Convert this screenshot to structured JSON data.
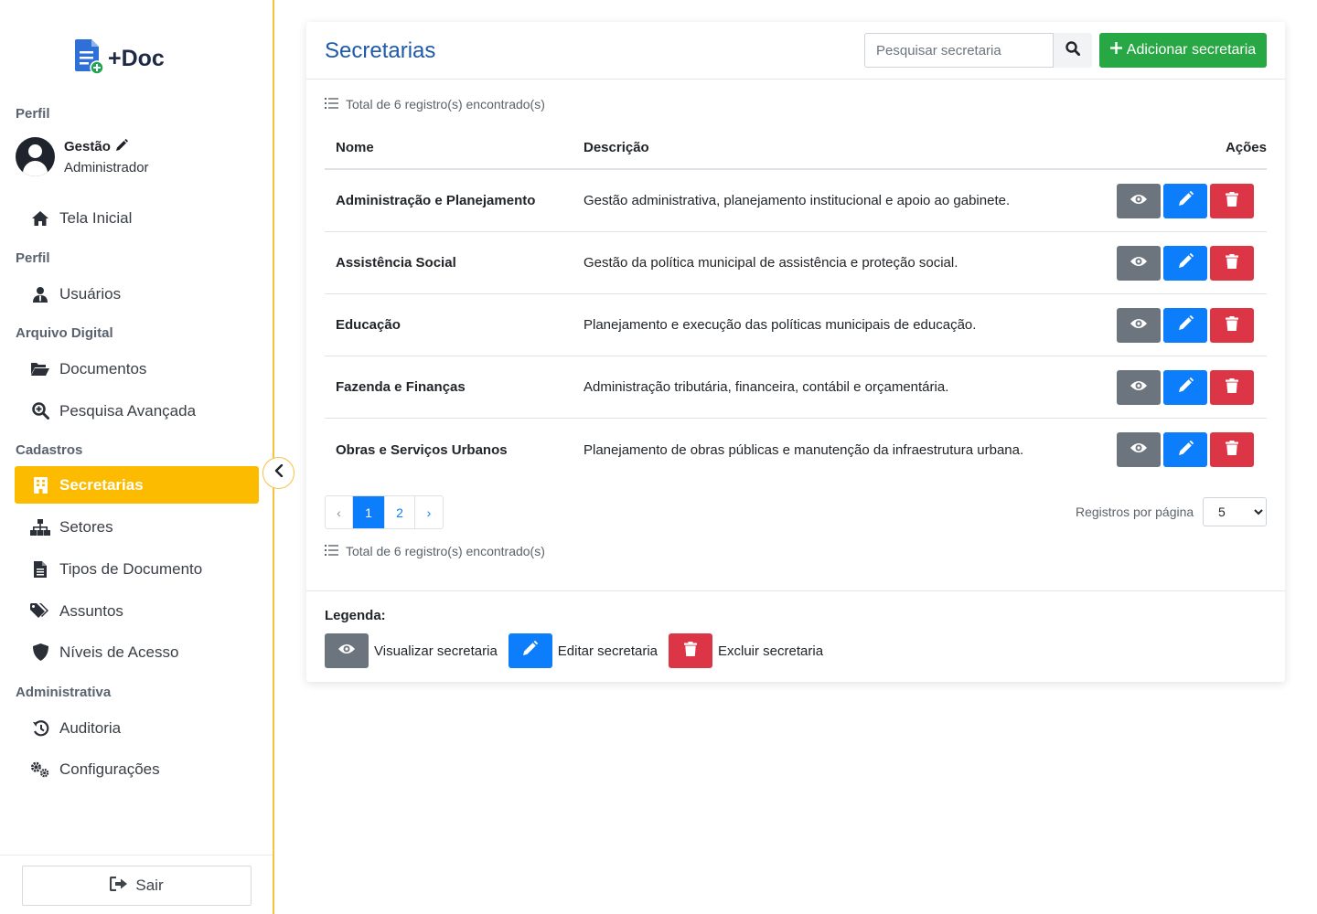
{
  "app": {
    "logo_text": "+Doc"
  },
  "sidebar": {
    "profile_section": "Perfil",
    "user": {
      "name": "Gestão",
      "role": "Administrador"
    },
    "home": "Tela Inicial",
    "perfil_section": "Perfil",
    "usuarios": "Usuários",
    "arquivo_section": "Arquivo Digital",
    "documentos": "Documentos",
    "pesquisa": "Pesquisa Avançada",
    "cadastros_section": "Cadastros",
    "secretarias": "Secretarias",
    "setores": "Setores",
    "tipos_documento": "Tipos de Documento",
    "assuntos": "Assuntos",
    "niveis_acesso": "Níveis de Acesso",
    "administrativa_section": "Administrativa",
    "auditoria": "Auditoria",
    "configuracoes": "Configurações",
    "logout": "Sair",
    "accent_color": "#fdbb00"
  },
  "main": {
    "title": "Secretarias",
    "search_placeholder": "Pesquisar secretaria",
    "add_button": "Adicionar secretaria",
    "total_text": "Total de 6 registro(s) encontrado(s)",
    "columns": {
      "name": "Nome",
      "description": "Descrição",
      "actions": "Ações"
    },
    "rows": [
      {
        "name": "Administração e Planejamento",
        "description": "Gestão administrativa, planejamento institucional e apoio ao gabinete."
      },
      {
        "name": "Assistência Social",
        "description": "Gestão da política municipal de assistência e proteção social."
      },
      {
        "name": "Educação",
        "description": "Planejamento e execução das políticas municipais de educação."
      },
      {
        "name": "Fazenda e Finanças",
        "description": "Administração tributária, financeira, contábil e orçamentária."
      },
      {
        "name": "Obras e Serviços Urbanos",
        "description": "Planejamento de obras públicas e manutenção da infraestrutura urbana."
      }
    ],
    "pagination": {
      "prev": "‹",
      "pages": [
        "1",
        "2"
      ],
      "current": "1",
      "next": "›"
    },
    "per_page_label": "Registros por página",
    "per_page_value": "5",
    "legend": {
      "title": "Legenda:",
      "view": "Visualizar secretaria",
      "edit": "Editar secretaria",
      "delete": "Excluir secretaria"
    },
    "colors": {
      "view": "#6c757d",
      "edit": "#0d7efb",
      "delete": "#dc3545",
      "add": "#28a745",
      "title": "#1e5aa8"
    }
  }
}
